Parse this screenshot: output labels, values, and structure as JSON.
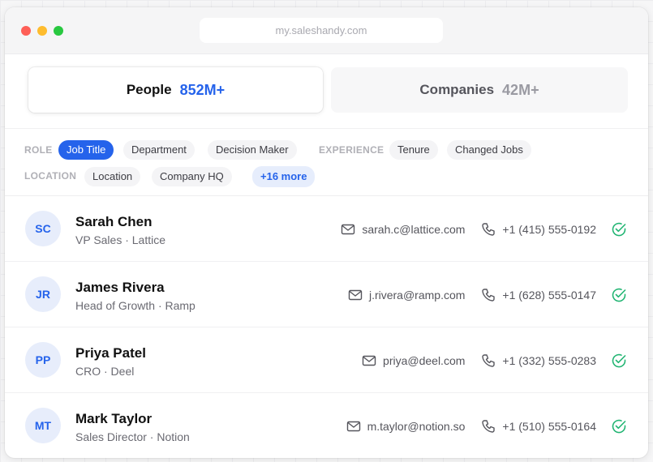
{
  "browser": {
    "url": "my.saleshandy.com"
  },
  "tabs": [
    {
      "label": "People",
      "count": "852M+"
    },
    {
      "label": "Companies",
      "count": "42M+"
    }
  ],
  "filters": {
    "role_label": "ROLE",
    "role_chips": [
      "Job Title",
      "Department",
      "Decision Maker"
    ],
    "experience_label": "EXPERIENCE",
    "experience_chips": [
      "Tenure",
      "Changed Jobs"
    ],
    "location_label": "LOCATION",
    "location_chips": [
      "Location",
      "Company HQ"
    ],
    "more_label": "+16 more"
  },
  "contacts": [
    {
      "initials": "SC",
      "name": "Sarah Chen",
      "subtitle": "VP Sales · Lattice",
      "email": "sarah.c@lattice.com",
      "phone": "+1 (415) 555-0192"
    },
    {
      "initials": "JR",
      "name": "James Rivera",
      "subtitle": "Head of Growth · Ramp",
      "email": "j.rivera@ramp.com",
      "phone": "+1 (628) 555-0147"
    },
    {
      "initials": "PP",
      "name": "Priya Patel",
      "subtitle": "CRO · Deel",
      "email": "priya@deel.com",
      "phone": "+1 (332) 555-0283"
    },
    {
      "initials": "MT",
      "name": "Mark Taylor",
      "subtitle": "Sales Director · Notion",
      "email": "m.taylor@notion.so",
      "phone": "+1 (510) 555-0164"
    }
  ],
  "colors": {
    "accent": "#2563eb",
    "verified": "#22b573"
  }
}
